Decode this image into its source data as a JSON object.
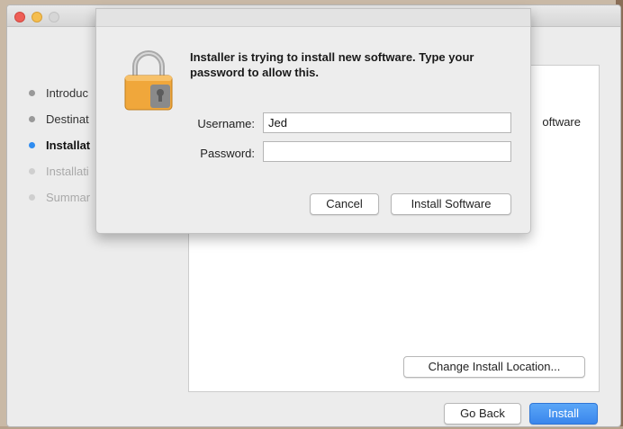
{
  "window": {
    "controls": [
      "close",
      "minimize",
      "zoom"
    ]
  },
  "sidebar": {
    "steps": [
      {
        "label": "Introduc",
        "state": "done"
      },
      {
        "label": "Destinat",
        "state": "done"
      },
      {
        "label": "Installat",
        "state": "active"
      },
      {
        "label": "Installati",
        "state": "future"
      },
      {
        "label": "Summar",
        "state": "future"
      }
    ]
  },
  "main": {
    "visible_text": "oftware",
    "change_location_label": "Change Install Location..."
  },
  "footer": {
    "go_back_label": "Go Back",
    "install_label": "Install"
  },
  "auth_dialog": {
    "icon": "lock-icon",
    "message": "Installer is trying to install new software. Type your password to allow this.",
    "username_label": "Username:",
    "username_value": "Jed",
    "password_label": "Password:",
    "password_value": "",
    "cancel_label": "Cancel",
    "install_software_label": "Install Software"
  },
  "colors": {
    "accent": "#3a86ec",
    "active_step_dot": "#2f8cf0",
    "lock_body": "#f0a73b"
  }
}
